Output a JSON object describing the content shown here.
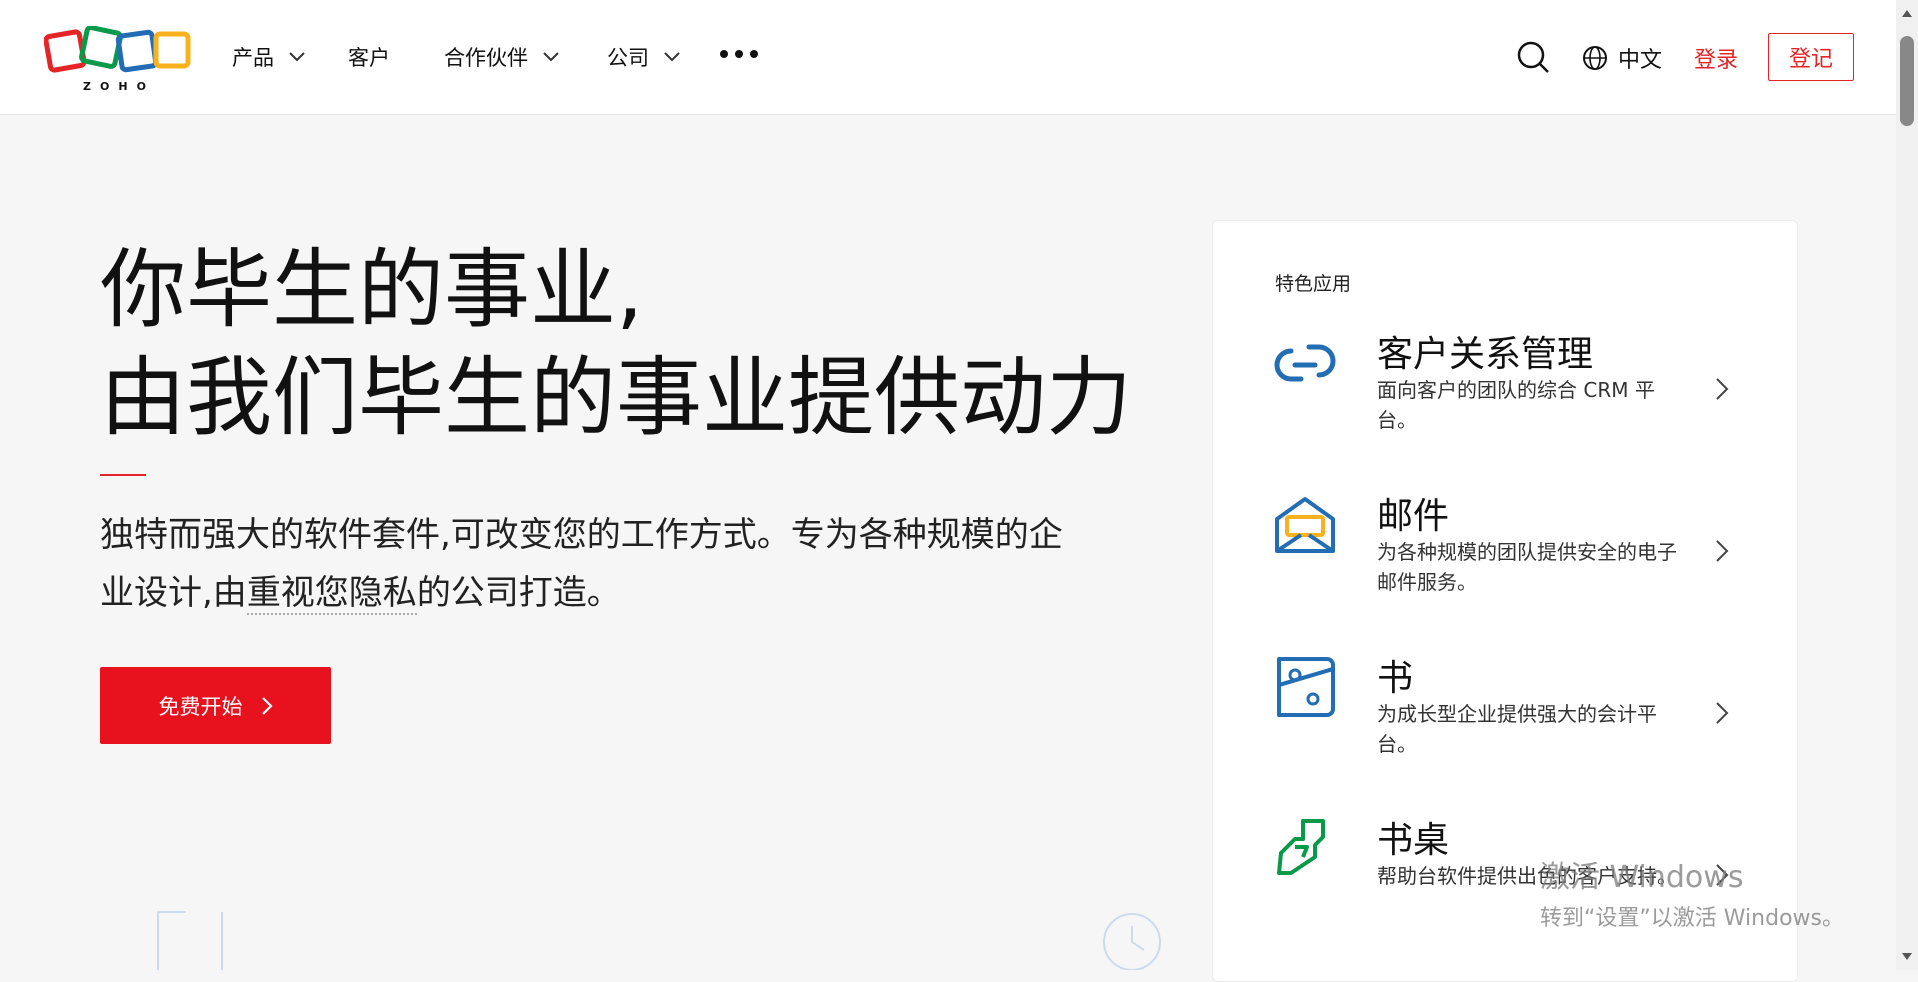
{
  "nav": {
    "logo_text": "ZOHO",
    "items": [
      {
        "label": "产品",
        "has_dropdown": true
      },
      {
        "label": "客户",
        "has_dropdown": false
      },
      {
        "label": "合作伙伴",
        "has_dropdown": true
      },
      {
        "label": "公司",
        "has_dropdown": true
      }
    ],
    "language": "中文",
    "login": "登录",
    "signup": "登记"
  },
  "hero": {
    "title_line1": "你毕生的事业,",
    "title_line2": "由我们毕生的事业提供动力",
    "desc_part1": "独特而强大的软件套件,可改变您的工作方式。专为各种规模的企业设计,由",
    "desc_link": "重视您隐私",
    "desc_part2": "的公司打造。",
    "cta": "免费开始"
  },
  "featured": {
    "heading": "特色应用",
    "apps": [
      {
        "name": "客户关系管理",
        "desc": "面向客户的团队的综合 CRM 平台。",
        "icon": "crm-icon"
      },
      {
        "name": "邮件",
        "desc": "为各种规模的团队提供安全的电子邮件服务。",
        "icon": "mail-icon"
      },
      {
        "name": "书",
        "desc": "为成长型企业提供强大的会计平台。",
        "icon": "books-icon"
      },
      {
        "name": "书桌",
        "desc": "帮助台软件提供出色的客户支持。",
        "icon": "desk-icon"
      }
    ]
  },
  "watermark": {
    "line1": "激活 Windows",
    "line2": "转到“设置”以激活 Windows。"
  },
  "colors": {
    "accent": "#e42527",
    "cta_bg": "#e8121f",
    "page_bg": "#f6f6f7"
  }
}
